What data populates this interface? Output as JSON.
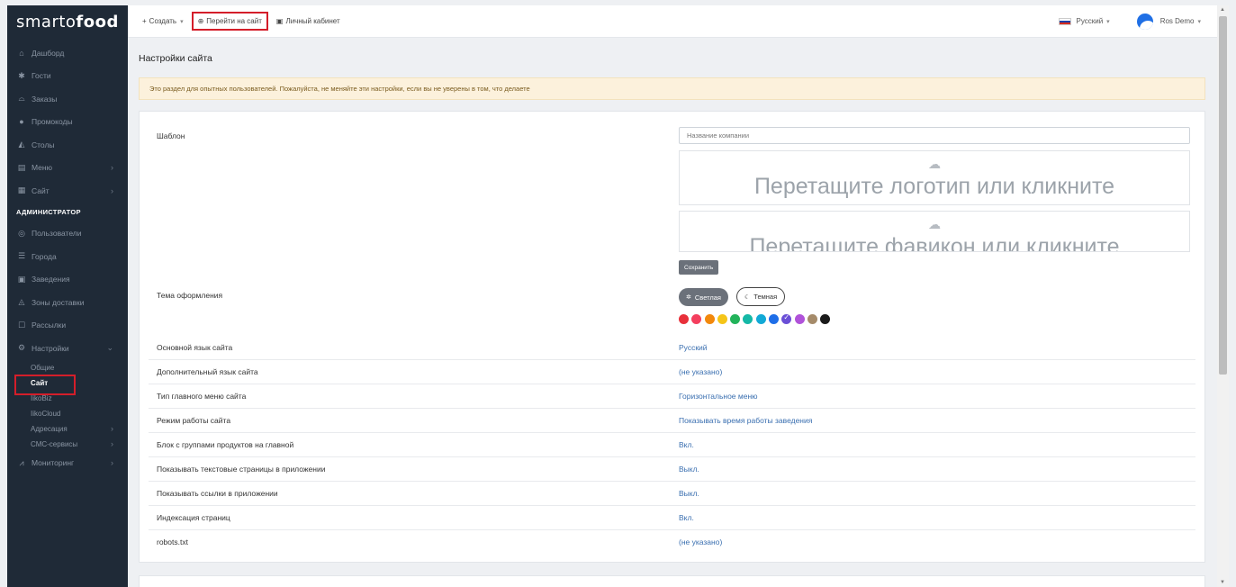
{
  "brand": {
    "logo_part1": "smarto",
    "logo_part2": "food"
  },
  "sidebar": {
    "items": [
      {
        "icon": "⌂",
        "label": "Дашборд",
        "chevron": false
      },
      {
        "icon": "✱",
        "label": "Гости",
        "chevron": false
      },
      {
        "icon": "⌓",
        "label": "Заказы",
        "chevron": false
      },
      {
        "icon": "●",
        "label": "Промокоды",
        "chevron": false
      },
      {
        "icon": "◭",
        "label": "Столы",
        "chevron": false
      },
      {
        "icon": "▤",
        "label": "Меню",
        "chevron": true
      },
      {
        "icon": "▦",
        "label": "Сайт",
        "chevron": true
      }
    ],
    "section_admin": "АДМИНИСТРАТОР",
    "admin_items": [
      {
        "icon": "◎",
        "label": "Пользователи",
        "chevron": false
      },
      {
        "icon": "☰",
        "label": "Города",
        "chevron": false
      },
      {
        "icon": "▣",
        "label": "Заведения",
        "chevron": false
      },
      {
        "icon": "◬",
        "label": "Зоны доставки",
        "chevron": false
      },
      {
        "icon": "☐",
        "label": "Рассылки",
        "chevron": false
      },
      {
        "icon": "⚙",
        "label": "Настройки",
        "chevron": true
      }
    ],
    "settings_sub": [
      {
        "label": "Общие",
        "chevron": false
      },
      {
        "label": "Сайт",
        "chevron": false
      },
      {
        "label": "IikoBiz",
        "chevron": false
      },
      {
        "label": "IikoCloud",
        "chevron": false
      },
      {
        "label": "Адресация",
        "chevron": true
      },
      {
        "label": "СМС-сервисы",
        "chevron": true
      }
    ],
    "monitoring": {
      "icon": "⩘",
      "label": "Мониторинг",
      "chevron": true
    }
  },
  "topbar": {
    "create_label": "Создать",
    "visit_site_label": "Перейти на сайт",
    "account_label": "Личный кабинет",
    "language_label": "Русский",
    "user_label": "Ros Demo"
  },
  "page": {
    "title": "Настройки сайта",
    "alert": "Это раздел для опытных пользователей. Пожалуйста, не меняйте эти настройки, если вы не уверены в том, что делаете"
  },
  "form": {
    "template_label": "Шаблон",
    "company_placeholder": "Название компании",
    "logo_drop_text": "Перетащите логотип или кликните",
    "favicon_drop_text": "Перетащите фавикон или кликните",
    "save_label": "Сохранить",
    "theme_label": "Тема оформления",
    "theme_light": "Светлая",
    "theme_dark": "Темная",
    "colors": [
      "#e8303a",
      "#f43f5e",
      "#f2880c",
      "#f5c518",
      "#22b35a",
      "#15b8a6",
      "#12a9d6",
      "#1e6ee8",
      "#6a4fd6",
      "#b052d9",
      "#a58b6a",
      "#1a1a1a"
    ],
    "selected_color_index": 8
  },
  "settings_rows": [
    {
      "label": "Основной язык сайта",
      "value": "Русский"
    },
    {
      "label": "Дополнительный язык сайта",
      "value": "(не указано)"
    },
    {
      "label": "Тип главного меню сайта",
      "value": "Горизонтальное меню"
    },
    {
      "label": "Режим работы сайта",
      "value": "Показывать время работы заведения"
    },
    {
      "label": "Блок с группами продуктов на главной",
      "value": "Вкл."
    },
    {
      "label": "Показывать текстовые страницы в приложении",
      "value": "Выкл."
    },
    {
      "label": "Показывать ссылки в приложении",
      "value": "Выкл."
    },
    {
      "label": "Индексация страниц",
      "value": "Вкл."
    },
    {
      "label": "robots.txt",
      "value": "(не указано)"
    }
  ]
}
